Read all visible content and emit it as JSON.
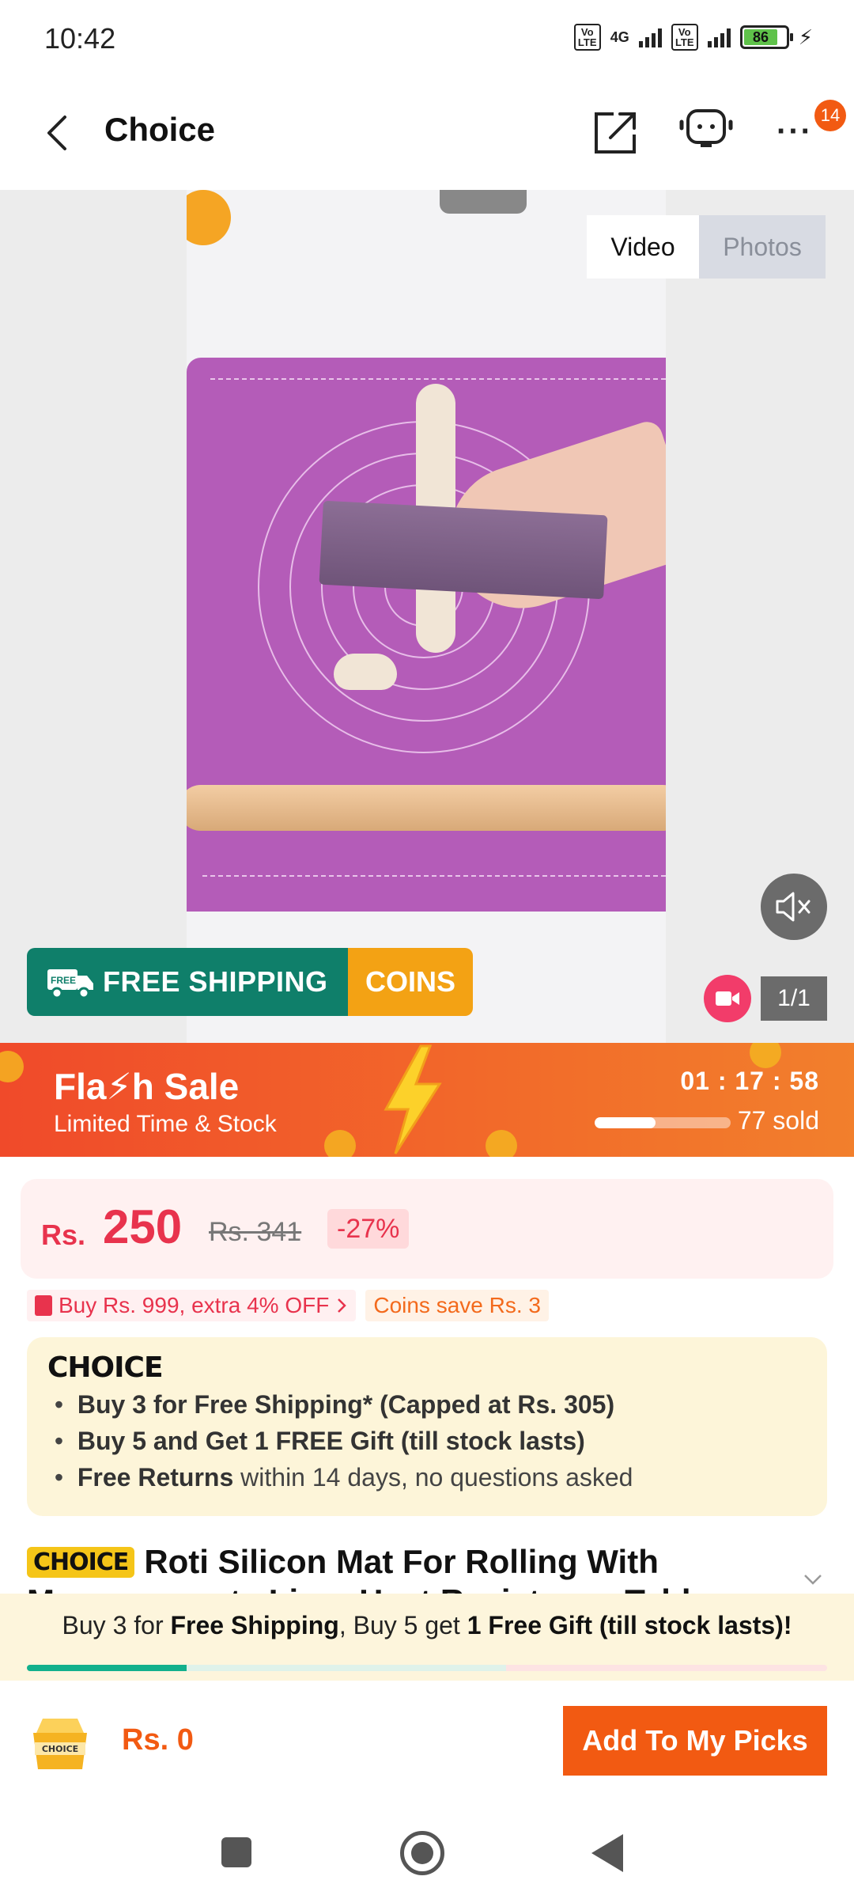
{
  "status_bar": {
    "time": "10:42",
    "network": "4G",
    "volte_label": "Vo LTE",
    "battery": "86"
  },
  "header": {
    "title": "Choice",
    "more_badge": "14"
  },
  "media": {
    "tab_video": "Video",
    "tab_photos": "Photos",
    "counter": "1/1",
    "ship_label": "FREE SHIPPING",
    "ship_badge": "FREE",
    "coins_label": "COINS"
  },
  "flash_sale": {
    "title": "Fla⚡h Sale",
    "subtitle": "Limited Time & Stock",
    "timer": "01 : 17 : 58",
    "sold_text": "77 sold",
    "sold_progress": 0.45
  },
  "price": {
    "currency": "Rs.",
    "value": "250",
    "original": "Rs. 341",
    "discount": "-27%"
  },
  "promos": {
    "coupon": "Buy Rs. 999, extra 4% OFF",
    "coins": "Coins save Rs. 3"
  },
  "choice": {
    "logo": "CHOICE",
    "benefit1": "Buy 3 for  Free Shipping* (Capped at Rs. 305)",
    "benefit2": "Buy 5 and Get 1 FREE Gift (till stock lasts)",
    "benefit3_bold": "Free Returns",
    "benefit3_rest": " within 14 days, no questions asked"
  },
  "product": {
    "tag": "CHOICE",
    "title": "Roti Silicon Mat For Rolling With",
    "title_line2": "Measurements Liner Heat Resistance Table"
  },
  "bundle": {
    "part1": "Buy 3 for ",
    "part2": "Free Shipping",
    "part3": ", Buy 5 get ",
    "part4": "1 Free Gift (till stock lasts)!"
  },
  "bottom_bar": {
    "cart_label": "CHOICE",
    "total": "Rs. 0",
    "add_button": "Add To My Picks"
  }
}
